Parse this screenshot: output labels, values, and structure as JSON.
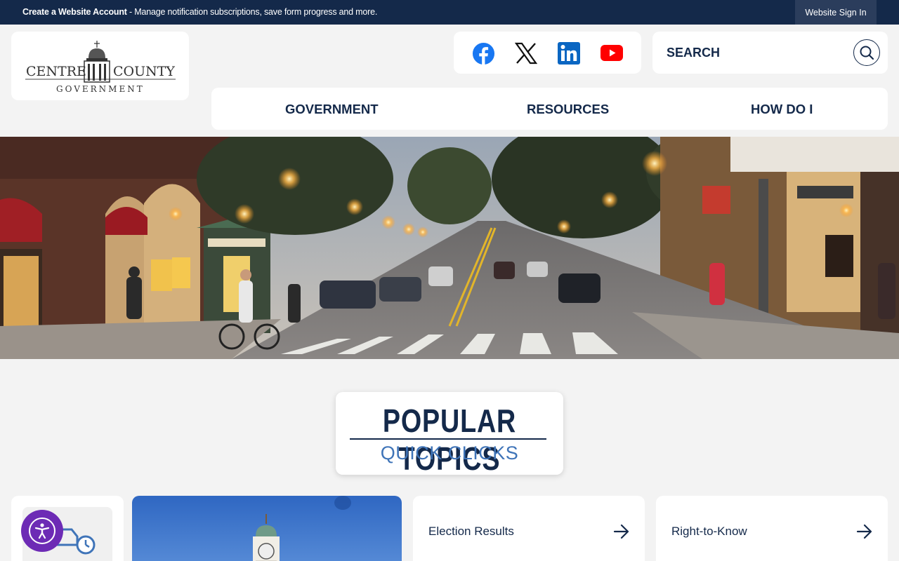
{
  "topbar": {
    "message_bold": "Create a Website Account",
    "message_rest": " - Manage notification subscriptions, save form progress and more.",
    "signin_label": "Website Sign In"
  },
  "logo": {
    "line1_left": "CENTRE",
    "line1_right": "COUNTY",
    "line2": "GOVERNMENT"
  },
  "social": {
    "items": [
      "facebook-icon",
      "x-icon",
      "linkedin-icon",
      "youtube-icon"
    ]
  },
  "search": {
    "placeholder": "SEARCH"
  },
  "nav": {
    "items": [
      {
        "label": "GOVERNMENT"
      },
      {
        "label": "RESOURCES"
      },
      {
        "label": "HOW DO I"
      }
    ]
  },
  "topics": {
    "title": "POPULAR TOPICS",
    "subtitle": "QUICK CLICKS"
  },
  "quick_links": [
    {
      "label": "Election Results"
    },
    {
      "label": "Right-to-Know"
    }
  ],
  "colors": {
    "navy": "#14294a",
    "accent_blue": "#3f74b8",
    "accessibility_purple": "#6d2bb5"
  }
}
